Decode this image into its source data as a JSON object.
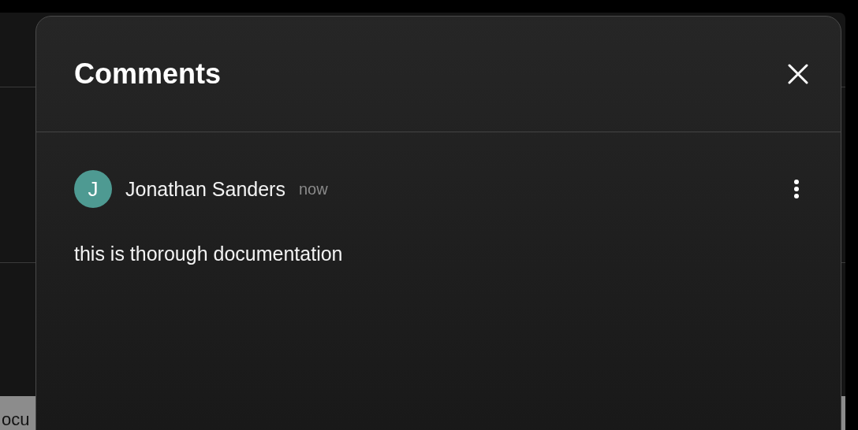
{
  "background": {
    "footer_text": "ocu"
  },
  "dialog": {
    "title": "Comments",
    "comments": [
      {
        "author": "Jonathan Sanders",
        "initial": "J",
        "color": "#4e9a92",
        "time": "now",
        "text": "this is thorough documentation"
      }
    ]
  }
}
